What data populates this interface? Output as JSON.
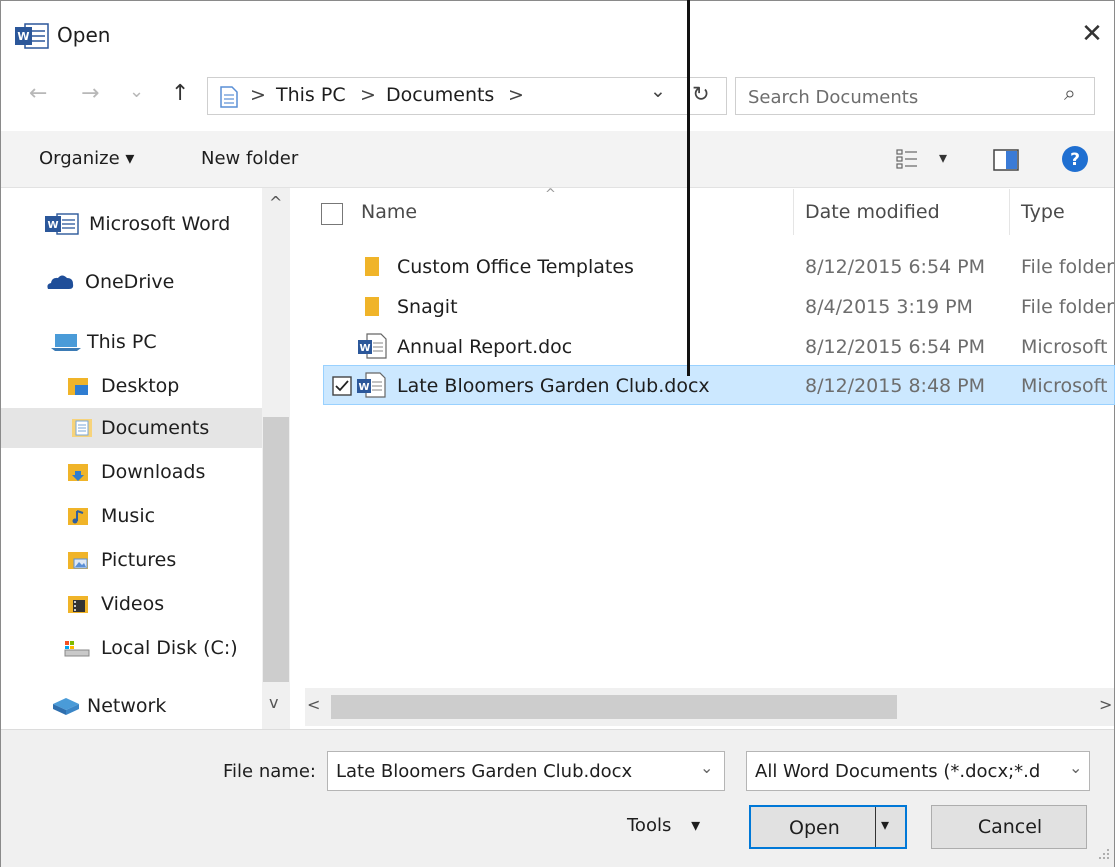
{
  "window": {
    "title": "Open",
    "close_glyph": "✕"
  },
  "address_bar": {
    "location_icon": "documents-location-icon",
    "crumbs": [
      "This PC",
      "Documents"
    ],
    "separator": ">",
    "dropdown_glyph": "⌄",
    "refresh_glyph": "↻"
  },
  "nav_buttons": {
    "back": "←",
    "forward": "→",
    "recent": "⌄",
    "up": "↑"
  },
  "search": {
    "placeholder": "Search Documents",
    "icon_glyph": "⌕"
  },
  "toolbar": {
    "organize_label": "Organize",
    "organize_caret": "▾",
    "new_folder_label": "New folder",
    "view_caret": "▾",
    "help_glyph": "?"
  },
  "nav_pane": {
    "items": [
      {
        "label": "Microsoft Word",
        "icon": "word-app-icon"
      },
      {
        "label": "OneDrive",
        "icon": "onedrive-cloud-icon"
      },
      {
        "label": "This PC",
        "icon": "this-pc-icon"
      },
      {
        "label": "Desktop",
        "icon": "desktop-folder-icon"
      },
      {
        "label": "Documents",
        "icon": "documents-folder-icon",
        "selected": true
      },
      {
        "label": "Downloads",
        "icon": "downloads-folder-icon"
      },
      {
        "label": "Music",
        "icon": "music-folder-icon"
      },
      {
        "label": "Pictures",
        "icon": "pictures-folder-icon"
      },
      {
        "label": "Videos",
        "icon": "videos-folder-icon"
      },
      {
        "label": "Local Disk (C:)",
        "icon": "local-disk-icon"
      },
      {
        "label": "Network",
        "icon": "network-icon"
      }
    ],
    "scroll_up": "^",
    "scroll_down": "v"
  },
  "file_list": {
    "sort_glyph": "^",
    "columns": {
      "name": "Name",
      "date": "Date modified",
      "type": "Type"
    },
    "rows": [
      {
        "name": "Custom Office Templates",
        "date": "8/12/2015 6:54 PM",
        "type": "File folder",
        "icon": "folder-icon"
      },
      {
        "name": "Snagit",
        "date": "8/4/2015 3:19 PM",
        "type": "File folder",
        "icon": "folder-icon"
      },
      {
        "name": "Annual Report.doc",
        "date": "8/12/2015 6:54 PM",
        "type": "Microsoft",
        "icon": "word-doc-icon"
      },
      {
        "name": "Late Bloomers Garden Club.docx",
        "date": "8/12/2015 8:48 PM",
        "type": "Microsoft",
        "icon": "word-doc-icon",
        "selected": true
      }
    ],
    "scroll_left": "<",
    "scroll_right": ">"
  },
  "bottom": {
    "file_name_label": "File name:",
    "file_name_value": "Late Bloomers Garden Club.docx",
    "combo_caret": "⌄",
    "file_type_value": "All Word Documents (*.docx;*.d",
    "tools_label": "Tools",
    "tools_caret": "▾",
    "open_label": "Open",
    "open_split_caret": "▾",
    "cancel_label": "Cancel"
  },
  "colors": {
    "accent": "#0078d7",
    "selection": "#cce8ff",
    "folder": "#f0b429",
    "word_blue": "#2b579a"
  }
}
